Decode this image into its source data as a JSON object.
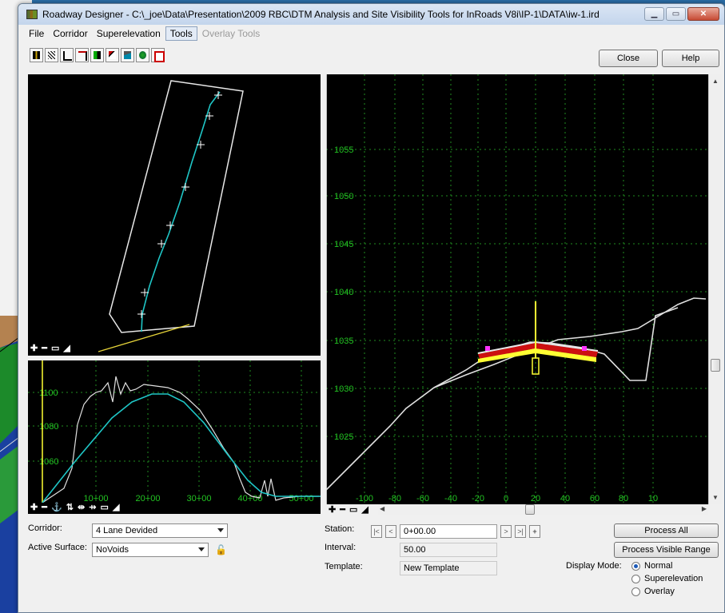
{
  "window": {
    "title": "Roadway Designer - C:\\_joe\\Data\\Presentation\\2009 RBC\\DTM Analysis and Site Visibility Tools for InRoads V8i\\IP-1\\DATA\\iw-1.ird",
    "minimize_icon": "minimize-icon",
    "maximize_icon": "maximize-icon",
    "close_icon": "close-icon"
  },
  "menu": {
    "items": [
      "File",
      "Corridor",
      "Superelevation",
      "Tools",
      "Overlay Tools"
    ],
    "active_item": "Tools",
    "disabled_item": "Overlay Tools"
  },
  "toolbar": {
    "icons": [
      "template-drop-icon",
      "key-station-icon",
      "point-controls-icon",
      "parametric-icon",
      "display-ribbon-icon",
      "superelevation-icon",
      "end-condition-icon",
      "surface-icon",
      "checkbox-icon"
    ]
  },
  "buttons": {
    "close": "Close",
    "help": "Help",
    "process_all": "Process All",
    "process_visible": "Process Visible Range"
  },
  "profile_view": {
    "y_ticks": [
      "1100",
      "1080",
      "1060"
    ],
    "x_ticks": [
      "10+00",
      "20+00",
      "30+00",
      "40+00",
      "50+00"
    ]
  },
  "cross_section": {
    "y_ticks": [
      "1055",
      "1050",
      "1045",
      "1040",
      "1035",
      "1030",
      "1025"
    ],
    "x_ticks": [
      "-100",
      "-80",
      "-60",
      "-40",
      "-20",
      "0",
      "20",
      "40",
      "60",
      "80",
      "10"
    ]
  },
  "pane_tools": {
    "plan": "✚ ━ ▭ ◢",
    "profile": "✚ ━ ⚓ ⇅ ⇹ ⇸ ▭ ◢",
    "section": "✚ ━ ▭ ◢"
  },
  "controls": {
    "corridor_label": "Corridor:",
    "corridor_value": "4 Lane Devided",
    "surface_label": "Active Surface:",
    "surface_value": "NoVoids",
    "station_label": "Station:",
    "station_value": "0+00.00",
    "interval_label": "Interval:",
    "interval_value": "50.00",
    "template_label": "Template:",
    "template_value": "New Template",
    "display_mode_label": "Display Mode:",
    "display_modes": [
      "Normal",
      "Superelevation",
      "Overlay"
    ],
    "selected_mode": "Normal",
    "nav": [
      "|<",
      "<",
      ">",
      ">|",
      "+"
    ],
    "lock_icon": "lock-icon"
  },
  "colors": {
    "alignment": "#1fc6c6",
    "grid": "#1f8c1f",
    "axis_label": "#22c322",
    "ground": "#e0e0e0",
    "template_yellow": "#ffff33",
    "template_red": "#cc1010",
    "marker_magenta": "#ff33ff"
  }
}
